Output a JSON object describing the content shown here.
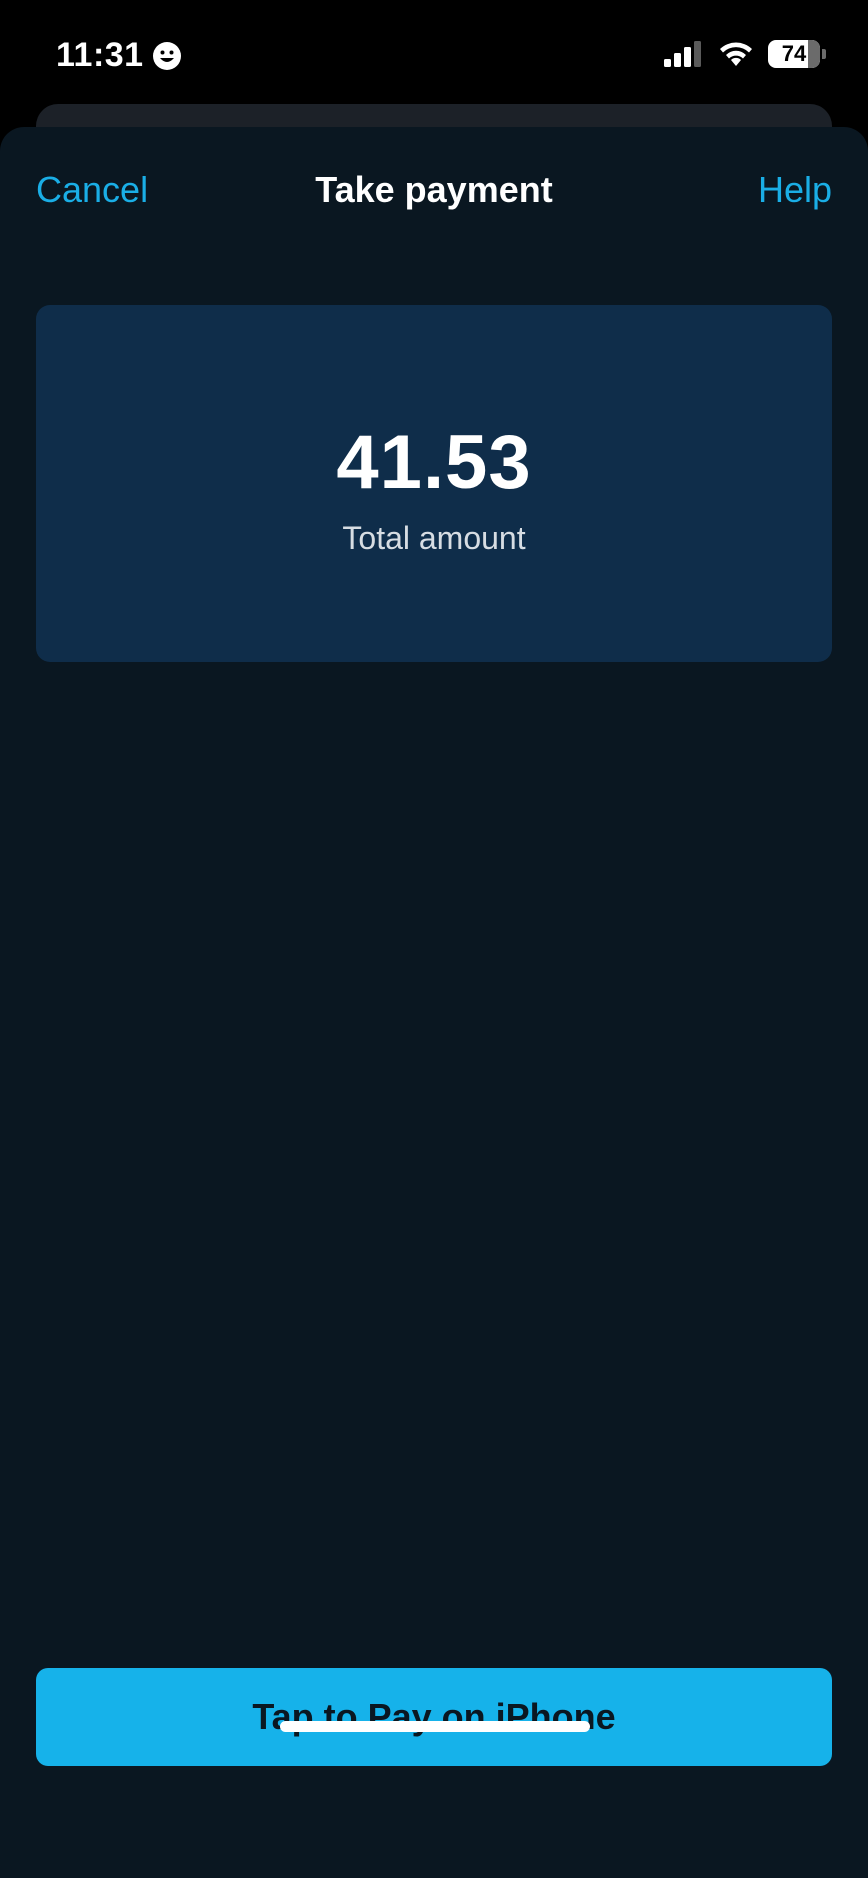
{
  "status_bar": {
    "time": "11:31",
    "battery": "74"
  },
  "nav": {
    "cancel_label": "Cancel",
    "title": "Take payment",
    "help_label": "Help"
  },
  "amount": {
    "value": "41.53",
    "label": "Total amount"
  },
  "action": {
    "pay_label": "Tap to Pay on iPhone"
  },
  "colors": {
    "accent": "#1aaee6",
    "button": "#16b2ea",
    "sheet_bg": "#0a1721",
    "card_bg": "#0f2d4a"
  },
  "icons": [
    "smiley-icon",
    "cellular-signal-icon",
    "wifi-icon",
    "battery-icon"
  ]
}
